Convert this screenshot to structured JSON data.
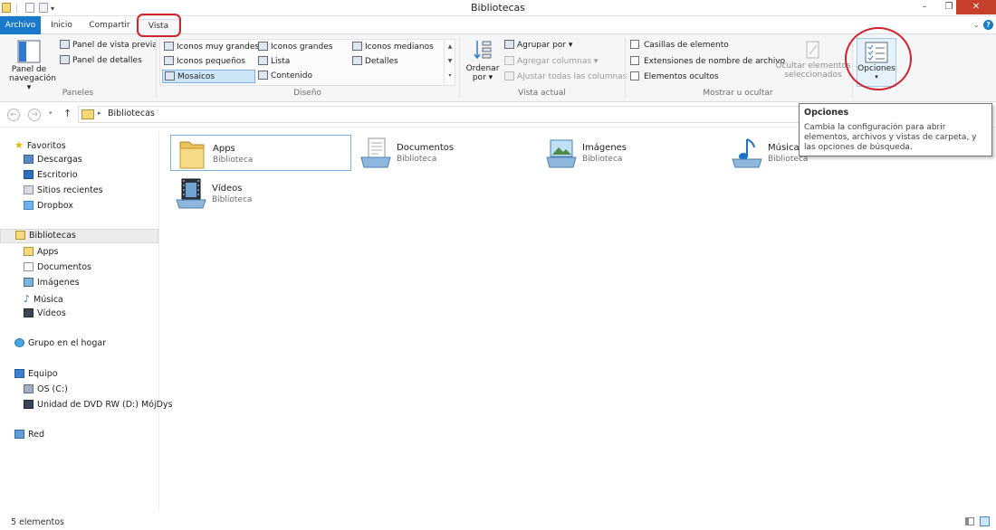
{
  "window": {
    "title": "Bibliotecas",
    "controls": [
      "–",
      "❐",
      "✕"
    ]
  },
  "tabs": [
    {
      "label": "Archivo"
    },
    {
      "label": "Inicio"
    },
    {
      "label": "Compartir"
    },
    {
      "label": "Vista",
      "selected": true
    }
  ],
  "ribbon": {
    "paneles": {
      "label": "Paneles",
      "nav_pane_line1": "Panel de",
      "nav_pane_line2": "navegación",
      "preview": "Panel de vista previa",
      "details": "Panel de detalles"
    },
    "diseno": {
      "label": "Diseño",
      "items": [
        "Iconos muy grandes",
        "Iconos grandes",
        "Iconos medianos",
        "Iconos pequeños",
        "Lista",
        "Detalles",
        "Mosaicos",
        "Contenido"
      ],
      "selected": "Mosaicos"
    },
    "vista_actual": {
      "label": "Vista actual",
      "sort_line1": "Ordenar",
      "sort_line2": "por",
      "group_by": "Agrupar por",
      "add_columns": "Agregar columnas",
      "fit_columns": "Ajustar todas las columnas"
    },
    "mostrar_ocultar": {
      "label": "Mostrar u ocultar",
      "item_checkboxes": "Casillas de elemento",
      "file_extensions": "Extensiones de nombre de archivo",
      "hidden_items": "Elementos ocultos",
      "hide_selected_line1": "Ocultar elementos",
      "hide_selected_line2": "seleccionados"
    },
    "opciones": {
      "label": "Opciones"
    }
  },
  "address": {
    "path": "Bibliotecas"
  },
  "nav_pane": {
    "favoritos": {
      "label": "Favoritos",
      "items": [
        "Descargas",
        "Escritorio",
        "Sitios recientes",
        "Dropbox"
      ]
    },
    "bibliotecas": {
      "label": "Bibliotecas",
      "items": [
        "Apps",
        "Documentos",
        "Imágenes",
        "Música",
        "Vídeos"
      ]
    },
    "grupo_hogar": "Grupo en el hogar",
    "equipo": {
      "label": "Equipo",
      "items": [
        "OS (C:)",
        "Unidad de DVD RW (D:) MójDys"
      ]
    },
    "red": "Red"
  },
  "libraries": [
    {
      "name": "Apps",
      "type": "Biblioteca",
      "icon": "folder-icon"
    },
    {
      "name": "Documentos",
      "type": "Biblioteca",
      "icon": "documents-library-icon"
    },
    {
      "name": "Imágenes",
      "type": "Biblioteca",
      "icon": "pictures-library-icon"
    },
    {
      "name": "Música",
      "type": "Biblioteca",
      "icon": "music-library-icon"
    },
    {
      "name": "Vídeos",
      "type": "Biblioteca",
      "icon": "videos-library-icon"
    }
  ],
  "tooltip": {
    "title": "Opciones",
    "body": "Cambia la configuración para abrir elementos, archivos y vistas de carpeta, y las opciones de búsqueda."
  },
  "status": {
    "count": "5 elementos"
  },
  "colors": {
    "accent": "#1979ca",
    "selection": "#cde6f7",
    "annotation": "#d2222a"
  }
}
